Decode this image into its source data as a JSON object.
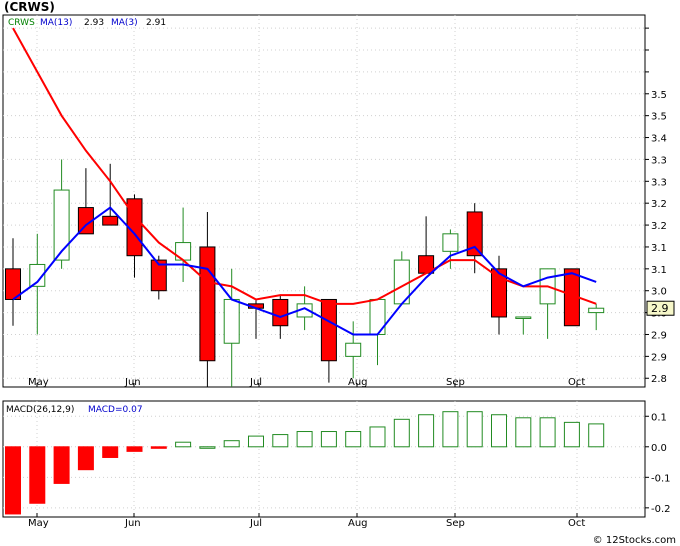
{
  "title": "(CRWS)",
  "footer": "© 12Stocks.com",
  "price_panel": {
    "legend": {
      "ticker": "CRWS",
      "ma13_label": "MA(13)",
      "ma13_value": "2.93",
      "ma3_label": "MA(3)",
      "ma3_value": "2.91"
    },
    "last_price_label": "2.9"
  },
  "macd_panel": {
    "legend": {
      "label": "MACD(26,12,9)",
      "value_label": "MACD=0.07"
    }
  },
  "colors": {
    "up_candle_stroke": "#228b22",
    "down_candle_fill": "#ff0000",
    "ma13": "#ff0000",
    "ma3": "#0000ff",
    "grid": "#d0d0d0",
    "axis": "#000000"
  },
  "chart_data": [
    {
      "type": "candlestick",
      "title": "(CRWS)",
      "ylim": [
        2.73,
        3.58
      ],
      "yticks": [
        2.8,
        2.9,
        3.0,
        3.1,
        3.2,
        3.3,
        3.4,
        3.5
      ],
      "ytick_labels": [
        "2.8",
        "2.9",
        "2.9",
        "3.0",
        "3.0",
        "3.1",
        "3.1",
        "3.2",
        "3.2",
        "3.3",
        "3.3",
        "3.4",
        "3.5",
        "3.5"
      ],
      "x_labels": [
        "May",
        "Jun",
        "Jul",
        "Aug",
        "Sep",
        "Oct"
      ],
      "grid": true,
      "candles": [
        {
          "open": 3.0,
          "high": 3.07,
          "low": 2.87,
          "close": 2.93
        },
        {
          "open": 2.96,
          "high": 3.08,
          "low": 2.85,
          "close": 3.01
        },
        {
          "open": 3.02,
          "high": 3.25,
          "low": 3.0,
          "close": 3.18
        },
        {
          "open": 3.14,
          "high": 3.23,
          "low": 3.1,
          "close": 3.08
        },
        {
          "open": 3.12,
          "high": 3.24,
          "low": 3.1,
          "close": 3.1
        },
        {
          "open": 3.16,
          "high": 3.17,
          "low": 2.98,
          "close": 3.03
        },
        {
          "open": 3.02,
          "high": 3.03,
          "low": 2.93,
          "close": 2.95
        },
        {
          "open": 3.02,
          "high": 3.14,
          "low": 2.97,
          "close": 3.06
        },
        {
          "open": 3.05,
          "high": 3.13,
          "low": 2.73,
          "close": 2.79
        },
        {
          "open": 2.83,
          "high": 3.0,
          "low": 2.73,
          "close": 2.93
        },
        {
          "open": 2.92,
          "high": 2.93,
          "low": 2.84,
          "close": 2.91
        },
        {
          "open": 2.93,
          "high": 2.94,
          "low": 2.84,
          "close": 2.87
        },
        {
          "open": 2.89,
          "high": 2.96,
          "low": 2.86,
          "close": 2.92
        },
        {
          "open": 2.93,
          "high": 2.93,
          "low": 2.74,
          "close": 2.79
        },
        {
          "open": 2.8,
          "high": 2.88,
          "low": 2.75,
          "close": 2.83
        },
        {
          "open": 2.85,
          "high": 2.93,
          "low": 2.78,
          "close": 2.93
        },
        {
          "open": 2.92,
          "high": 3.04,
          "low": 2.92,
          "close": 3.02
        },
        {
          "open": 3.03,
          "high": 3.12,
          "low": 2.99,
          "close": 2.99
        },
        {
          "open": 3.04,
          "high": 3.09,
          "low": 3.0,
          "close": 3.08
        },
        {
          "open": 3.13,
          "high": 3.15,
          "low": 2.99,
          "close": 3.03
        },
        {
          "open": 3.0,
          "high": 3.03,
          "low": 2.85,
          "close": 2.89
        },
        {
          "open": 2.89,
          "high": 2.89,
          "low": 2.85,
          "close": 2.89
        },
        {
          "open": 2.92,
          "high": 3.0,
          "low": 2.84,
          "close": 3.0
        },
        {
          "open": 3.0,
          "high": 3.0,
          "low": 2.87,
          "close": 2.87
        },
        {
          "open": 2.9,
          "high": 2.92,
          "low": 2.86,
          "close": 2.91
        }
      ],
      "series": [
        {
          "name": "MA(13)",
          "values": [
            3.55,
            3.45,
            3.35,
            3.27,
            3.2,
            3.12,
            3.06,
            3.02,
            2.97,
            2.96,
            2.93,
            2.94,
            2.94,
            2.92,
            2.92,
            2.93,
            2.96,
            2.99,
            3.02,
            3.02,
            2.98,
            2.96,
            2.96,
            2.94,
            2.92
          ]
        },
        {
          "name": "MA(3)",
          "values": [
            2.93,
            2.97,
            3.04,
            3.1,
            3.14,
            3.08,
            3.01,
            3.01,
            3.0,
            2.93,
            2.91,
            2.89,
            2.91,
            2.88,
            2.85,
            2.85,
            2.92,
            2.98,
            3.03,
            3.05,
            2.99,
            2.96,
            2.98,
            2.99,
            2.97
          ]
        }
      ]
    },
    {
      "type": "bar",
      "title": "MACD(26,12,9)",
      "ylim": [
        -0.23,
        0.15
      ],
      "yticks": [
        0.1,
        0.0,
        -0.1,
        -0.2
      ],
      "ytick_labels": [
        "0.1",
        "0.0",
        "-0.1",
        "-0.2"
      ],
      "x_labels": [
        "May",
        "Jun",
        "Jul",
        "Aug",
        "Sep",
        "Oct"
      ],
      "grid": true,
      "values": [
        -0.22,
        -0.185,
        -0.12,
        -0.075,
        -0.035,
        -0.015,
        -0.005,
        0.015,
        0.0,
        0.02,
        0.035,
        0.04,
        0.05,
        0.05,
        0.05,
        0.065,
        0.09,
        0.105,
        0.115,
        0.115,
        0.105,
        0.095,
        0.095,
        0.08,
        0.075
      ]
    }
  ]
}
